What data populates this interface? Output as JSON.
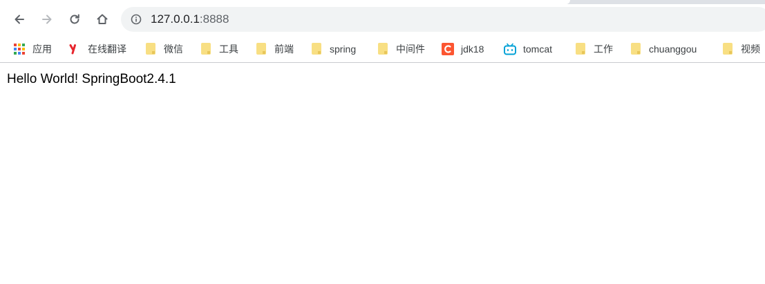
{
  "browser": {
    "nav": {
      "back_icon": "arrow-left-icon",
      "forward_icon": "arrow-right-icon",
      "reload_icon": "reload-icon",
      "home_icon": "home-icon"
    },
    "omnibox": {
      "host": "127.0.0.1",
      "port": ":8888",
      "info_icon": "info-icon"
    },
    "bookmarks": [
      {
        "label": "应用",
        "icon": "apps-grid-icon"
      },
      {
        "label": "在线翻译",
        "icon": "youdao-icon"
      },
      {
        "label": "微信",
        "icon": "folder-icon"
      },
      {
        "label": "工具",
        "icon": "folder-icon"
      },
      {
        "label": "前端",
        "icon": "folder-icon"
      },
      {
        "label": "spring",
        "icon": "folder-icon"
      },
      {
        "label": "中间件",
        "icon": "folder-icon"
      },
      {
        "label": "jdk18",
        "icon": "csdn-icon"
      },
      {
        "label": "tomcat",
        "icon": "bilibili-icon"
      },
      {
        "label": "工作",
        "icon": "folder-icon"
      },
      {
        "label": "chuanggou",
        "icon": "folder-icon"
      },
      {
        "label": "视频",
        "icon": "folder-icon"
      }
    ],
    "colors": {
      "csdn": "#fc5531",
      "youdao": "#e7252d",
      "bilibili": "#00a1d6",
      "folder": "#f8df83"
    }
  },
  "page": {
    "text": "Hello World! SpringBoot2.4.1"
  }
}
